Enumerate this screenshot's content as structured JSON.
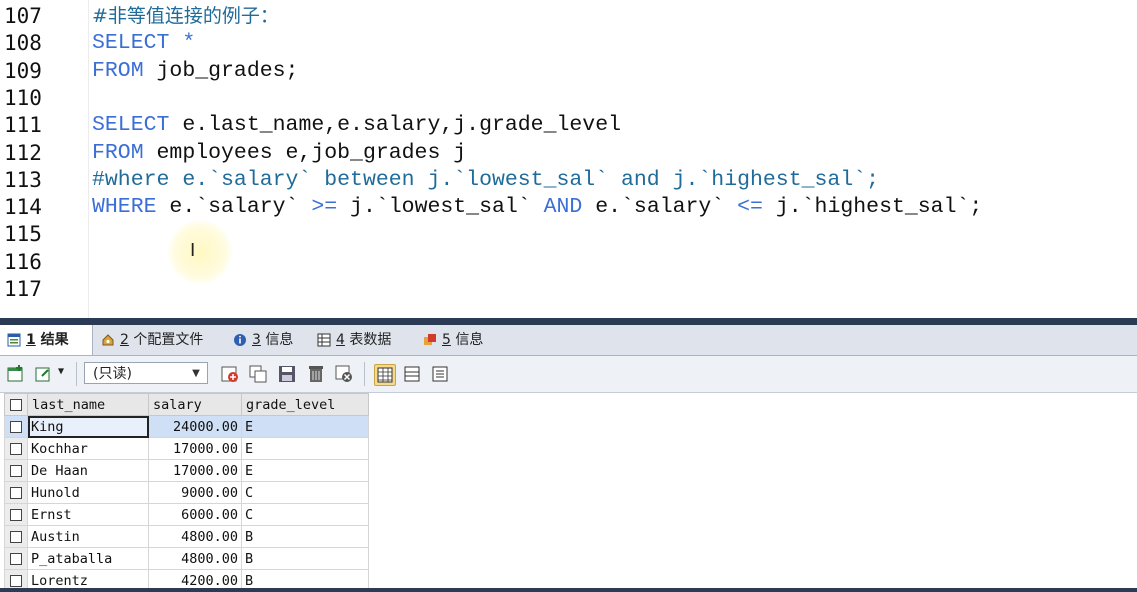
{
  "editor": {
    "lines": [
      {
        "n": "107",
        "segments": [
          {
            "t": "#非等值连接的例子：",
            "c": "cm zh"
          }
        ]
      },
      {
        "n": "108",
        "segments": [
          {
            "t": "SELECT",
            "c": "kw"
          },
          {
            "t": " *",
            "c": "kw"
          }
        ]
      },
      {
        "n": "109",
        "segments": [
          {
            "t": "FROM",
            "c": "kw"
          },
          {
            "t": " job_grades;",
            "c": ""
          }
        ]
      },
      {
        "n": "110",
        "segments": []
      },
      {
        "n": "111",
        "segments": [
          {
            "t": "SELECT",
            "c": "kw"
          },
          {
            "t": " e.last_name,e.salary,j.grade_level",
            "c": ""
          }
        ]
      },
      {
        "n": "112",
        "segments": [
          {
            "t": "FROM",
            "c": "kw"
          },
          {
            "t": " employees e,job_grades j",
            "c": ""
          }
        ]
      },
      {
        "n": "113",
        "segments": [
          {
            "t": "#where e.`salary` between j.`lowest_sal` and j.`highest_sal`;",
            "c": "cm"
          }
        ]
      },
      {
        "n": "114",
        "segments": [
          {
            "t": "WHERE",
            "c": "kw"
          },
          {
            "t": " e.`salary` ",
            "c": ""
          },
          {
            "t": ">=",
            "c": "kw"
          },
          {
            "t": " j.`lowest_sal` ",
            "c": ""
          },
          {
            "t": "AND",
            "c": "kw"
          },
          {
            "t": " e.`salary` ",
            "c": ""
          },
          {
            "t": "<=",
            "c": "kw"
          },
          {
            "t": " j.`highest_sal`;",
            "c": ""
          }
        ]
      },
      {
        "n": "115",
        "segments": []
      },
      {
        "n": "116",
        "segments": []
      },
      {
        "n": "117",
        "segments": []
      }
    ],
    "cursor_glyph": "I"
  },
  "tabs": [
    {
      "num": "1",
      "label": "结果",
      "icon": "result-grid-icon",
      "active": true
    },
    {
      "num": "2",
      "label": "个配置文件",
      "icon": "profile-icon",
      "active": false
    },
    {
      "num": "3",
      "label": "信息",
      "icon": "info-icon",
      "active": false
    },
    {
      "num": "4",
      "label": "表数据",
      "icon": "table-data-icon",
      "active": false
    },
    {
      "num": "5",
      "label": "信息",
      "icon": "info-icon",
      "active": false
    }
  ],
  "toolbar": {
    "mode_select": "(只读)"
  },
  "grid": {
    "columns": [
      "last_name",
      "salary",
      "grade_level"
    ],
    "rows": [
      [
        "King",
        "24000.00",
        "E"
      ],
      [
        "Kochhar",
        "17000.00",
        "E"
      ],
      [
        "De Haan",
        "17000.00",
        "E"
      ],
      [
        "Hunold",
        "9000.00",
        "C"
      ],
      [
        "Ernst",
        "6000.00",
        "C"
      ],
      [
        "Austin",
        "4800.00",
        "B"
      ],
      [
        "P_ataballa",
        "4800.00",
        "B"
      ],
      [
        "Lorentz",
        "4200.00",
        "B"
      ]
    ]
  },
  "colors": {
    "keyword": "#3b6fd6",
    "comment": "#1f6b9a",
    "separator": "#2b3b55",
    "selected_row": "#cfe0f6"
  }
}
